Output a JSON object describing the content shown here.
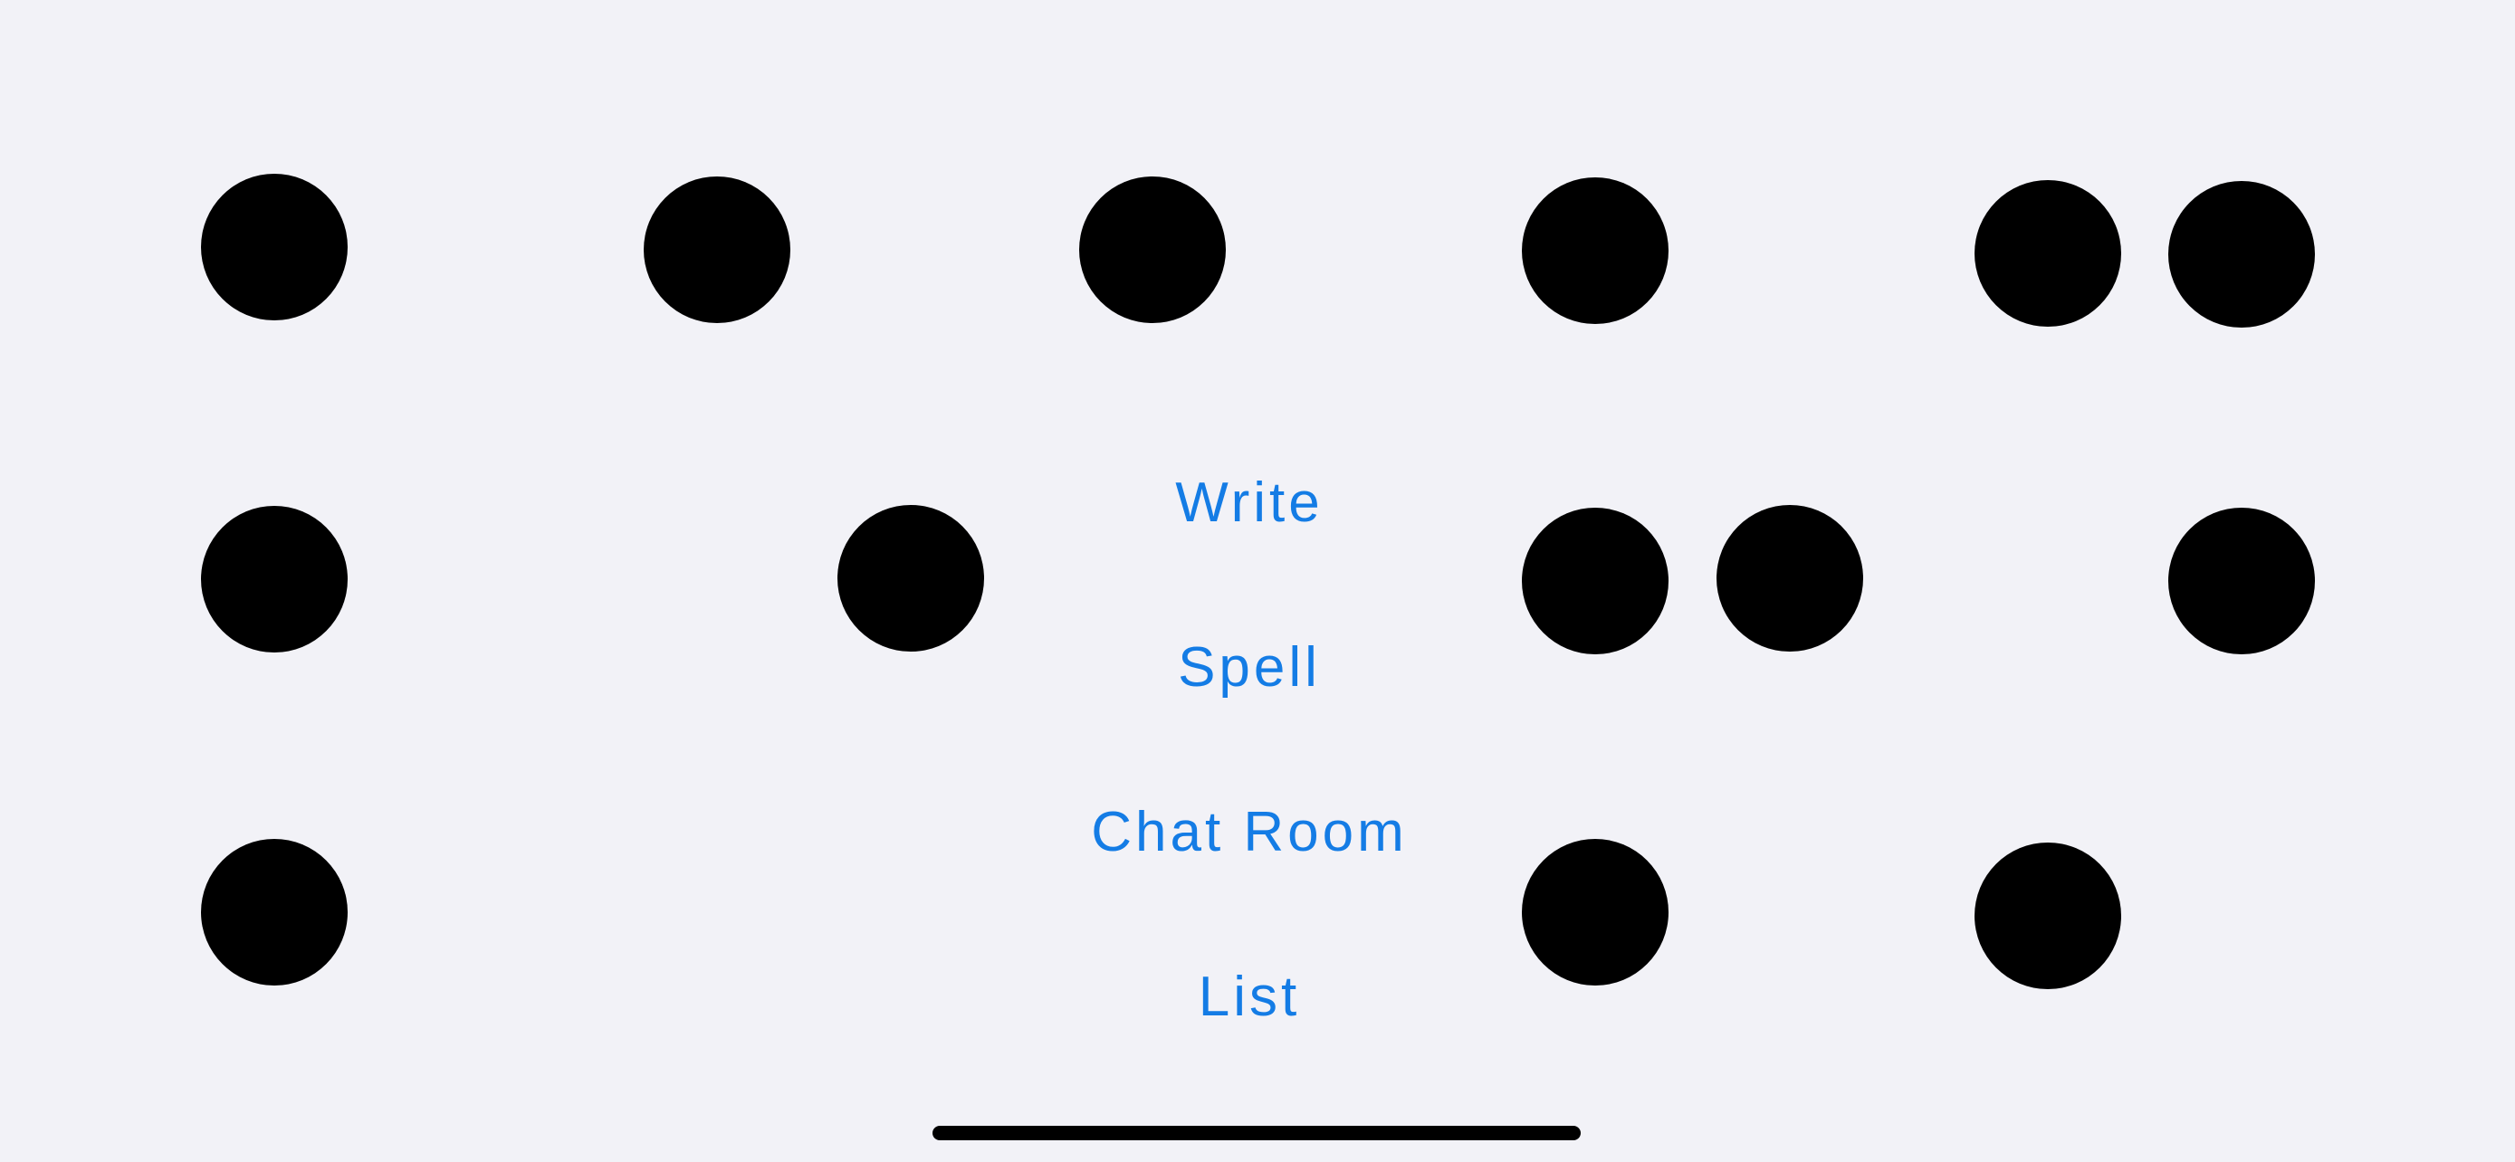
{
  "menu": {
    "write_label": "Write",
    "spell_label": "Spell",
    "chat_room_label": "Chat Room",
    "list_label": "List"
  },
  "colors": {
    "background": "#f2f2f7",
    "accent": "#147ce5",
    "dot": "#000000"
  }
}
